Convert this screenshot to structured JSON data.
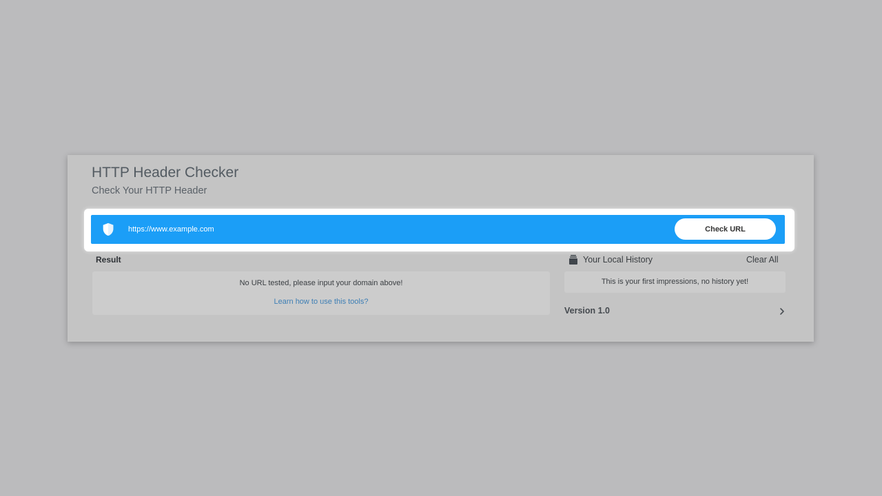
{
  "header": {
    "title": "HTTP Header Checker",
    "subtitle": "Check Your HTTP Header"
  },
  "url_bar": {
    "placeholder": "https://www.example.com",
    "value": "",
    "check_button_label": "Check URL",
    "bar_color": "#1b9ef7",
    "icon": "shield-icon"
  },
  "result": {
    "label": "Result",
    "message": "No URL tested, please input your domain above!",
    "help_link": "Learn how to use this tools?"
  },
  "history": {
    "icon": "history-stack-icon",
    "title": "Your Local History",
    "clear_label": "Clear All",
    "empty_message": "This is your first impressions, no history yet!"
  },
  "version": {
    "label": "Version 1.0",
    "icon": "chevron-right-icon"
  }
}
